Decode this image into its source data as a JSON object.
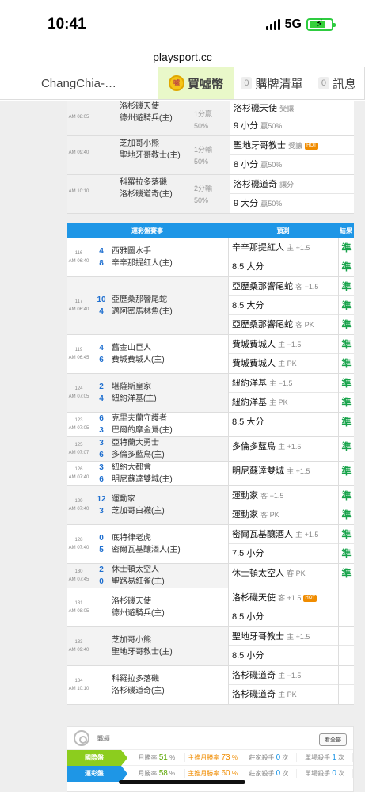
{
  "status_bar": {
    "time": "10:41",
    "network": "5G"
  },
  "browser": {
    "url": "playsport.cc"
  },
  "nav": {
    "user": "ChangChia-…",
    "buy": "買噓幣",
    "cart_count": "0",
    "cart": "購牌清單",
    "msg_count": "0",
    "msg": "訊息"
  },
  "past_games": [
    {
      "time": "AM 08:05",
      "team1": "洛杉磯天使",
      "team2": "德州遊騎兵(主)",
      "result1": "1分贏",
      "result2": "50%",
      "pred1": "洛杉磯天使",
      "pred1_note": "受讓",
      "pred1_tag": "",
      "pred2": "9 小分",
      "pred2_note": "贏50%"
    },
    {
      "time": "AM 09:40",
      "team1": "芝加哥小熊",
      "team2": "聖地牙哥教士(主)",
      "result1": "1分輸",
      "result2": "50%",
      "pred1": "聖地牙哥教士",
      "pred1_note": "受讓",
      "pred1_tag": "HOT",
      "pred2": "8 小分",
      "pred2_note": "贏50%"
    },
    {
      "time": "AM 10:10",
      "team1": "科羅拉多落磯",
      "team2": "洛杉磯道奇(主)",
      "result1": "2分輸",
      "result2": "50%",
      "pred1": "洛杉磯道奇",
      "pred1_note": "讓分",
      "pred1_tag": "",
      "pred2": "9 大分",
      "pred2_note": "贏50%"
    }
  ],
  "table": {
    "head_game": "運彩盤賽事",
    "head_pred": "預測",
    "head_result": "結果",
    "rows": [
      {
        "num": "116",
        "time": "AM 06:40",
        "s1": "4",
        "s2": "8",
        "t1": "西雅圖水手",
        "t2": "辛辛那提紅人(主)",
        "preds": [
          {
            "main": "辛辛那提紅人",
            "note": "主 +1.5"
          },
          {
            "main": "8.5 大分",
            "note": ""
          }
        ],
        "results": [
          "準",
          "準"
        ]
      },
      {
        "num": "117",
        "time": "AM 06:40",
        "s1": "10",
        "s2": "4",
        "t1": "亞歷桑那響尾蛇",
        "t2": "邁阿密馬林魚(主)",
        "preds": [
          {
            "main": "亞歷桑那響尾蛇",
            "note": "客 −1.5"
          },
          {
            "main": "8.5 大分",
            "note": ""
          },
          {
            "main": "亞歷桑那響尾蛇",
            "note": "客 PK"
          }
        ],
        "results": [
          "準",
          "準",
          "準"
        ]
      },
      {
        "num": "119",
        "time": "AM 06:45",
        "s1": "4",
        "s2": "6",
        "t1": "舊金山巨人",
        "t2": "費城費城人(主)",
        "preds": [
          {
            "main": "費城費城人",
            "note": "主 −1.5"
          },
          {
            "main": "費城費城人",
            "note": "主 PK"
          }
        ],
        "results": [
          "準",
          "準"
        ]
      },
      {
        "num": "124",
        "time": "AM 07:05",
        "s1": "2",
        "s2": "4",
        "t1": "堪薩斯皇家",
        "t2": "紐約洋基(主)",
        "preds": [
          {
            "main": "紐約洋基",
            "note": "主 −1.5"
          },
          {
            "main": "紐約洋基",
            "note": "主 PK"
          }
        ],
        "results": [
          "準",
          "準"
        ]
      },
      {
        "num": "123",
        "time": "AM 07:05",
        "s1": "6",
        "s2": "3",
        "t1": "克里夫蘭守護者",
        "t2": "巴爾的摩金鶯(主)",
        "preds": [
          {
            "main": "8.5 大分",
            "note": ""
          }
        ],
        "results": [
          "準"
        ]
      },
      {
        "num": "125",
        "time": "AM 07:07",
        "s1": "3",
        "s2": "6",
        "t1": "亞特蘭大勇士",
        "t2": "多倫多藍鳥(主)",
        "preds": [
          {
            "main": "多倫多藍鳥",
            "note": "主 +1.5"
          }
        ],
        "results": [
          "準"
        ]
      },
      {
        "num": "126",
        "time": "AM 07:40",
        "s1": "3",
        "s2": "6",
        "t1": "紐約大都會",
        "t2": "明尼蘇達雙城(主)",
        "preds": [
          {
            "main": "明尼蘇達雙城",
            "note": "主 +1.5"
          }
        ],
        "results": [
          "準"
        ]
      },
      {
        "num": "129",
        "time": "AM 07:40",
        "s1": "12",
        "s2": "3",
        "t1": "運動家",
        "t2": "芝加哥白襪(主)",
        "preds": [
          {
            "main": "運動家",
            "note": "客 −1.5"
          },
          {
            "main": "運動家",
            "note": "客 PK"
          }
        ],
        "results": [
          "準",
          "準"
        ]
      },
      {
        "num": "128",
        "time": "AM 07:40",
        "s1": "0",
        "s2": "5",
        "t1": "底特律老虎",
        "t2": "密爾瓦基釀酒人(主)",
        "preds": [
          {
            "main": "密爾瓦基釀酒人",
            "note": "主 +1.5"
          },
          {
            "main": "7.5 小分",
            "note": ""
          }
        ],
        "results": [
          "準",
          "準"
        ]
      },
      {
        "num": "130",
        "time": "AM 07:45",
        "s1": "2",
        "s2": "0",
        "t1": "休士頓太空人",
        "t2": "聖路易紅雀(主)",
        "preds": [
          {
            "main": "休士頓太空人",
            "note": "客 PK"
          }
        ],
        "results": [
          "準"
        ]
      },
      {
        "num": "131",
        "time": "AM 08:05",
        "s1": "",
        "s2": "",
        "t1": "洛杉磯天使",
        "t2": "德州遊騎兵(主)",
        "preds": [
          {
            "main": "洛杉磯天使",
            "note": "客 +1.5",
            "tag": "HOT"
          },
          {
            "main": "8.5 小分",
            "note": ""
          }
        ],
        "results": [
          "",
          ""
        ]
      },
      {
        "num": "133",
        "time": "AM 09:40",
        "s1": "",
        "s2": "",
        "t1": "芝加哥小熊",
        "t2": "聖地牙哥教士(主)",
        "preds": [
          {
            "main": "聖地牙哥教士",
            "note": "主 +1.5"
          },
          {
            "main": "8.5 小分",
            "note": ""
          }
        ],
        "results": [
          "",
          ""
        ]
      },
      {
        "num": "134",
        "time": "AM 10:10",
        "s1": "",
        "s2": "",
        "t1": "科羅拉多落磯",
        "t2": "洛杉磯道奇(主)",
        "preds": [
          {
            "main": "洛杉磯道奇",
            "note": "主 −1.5"
          },
          {
            "main": "洛杉磯道奇",
            "note": "主 PK"
          }
        ],
        "results": [
          "",
          ""
        ]
      }
    ]
  },
  "stats": {
    "title": "戰績",
    "all_button": "看全部",
    "rows": [
      {
        "label": "國際盤",
        "c1_label": "月勝率",
        "c1_val": "51",
        "c1_unit": "%",
        "c2_label": "主推月勝率",
        "c2_val": "73",
        "c2_unit": "%",
        "c3_label": "莊家殺手",
        "c3_val": "0",
        "c3_unit": "次",
        "c4_label": "單場殺手",
        "c4_val": "1",
        "c4_unit": "次"
      },
      {
        "label": "運彩盤",
        "c1_label": "月勝率",
        "c1_val": "58",
        "c1_unit": "%",
        "c2_label": "主推月勝率",
        "c2_val": "60",
        "c2_unit": "%",
        "c3_label": "莊家殺手",
        "c3_val": "0",
        "c3_unit": "次",
        "c4_label": "單場殺手",
        "c4_val": "0",
        "c4_unit": "次"
      }
    ]
  }
}
